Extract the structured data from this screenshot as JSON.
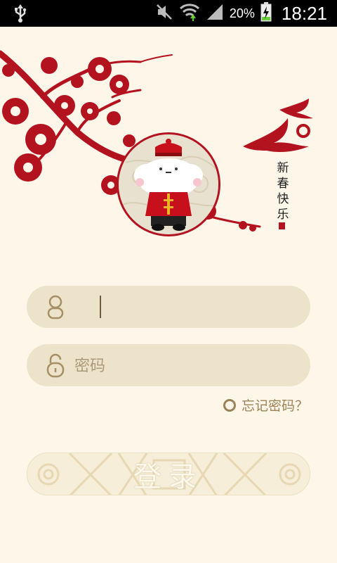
{
  "status_bar": {
    "battery_percent": "20%",
    "time": "18:21",
    "icons": [
      "usb-icon",
      "mute-icon",
      "wifi-icon",
      "signal-icon",
      "battery-icon"
    ]
  },
  "hero": {
    "greeting_chars": [
      "新",
      "春",
      "快",
      "乐"
    ],
    "icons": [
      "plum-blossom-branch",
      "swallow-birds",
      "mascot-avatar"
    ]
  },
  "login_form": {
    "username": {
      "value": "",
      "placeholder": ""
    },
    "password": {
      "value": "",
      "placeholder": "密码"
    },
    "forgot_password_label": "忘记密码？",
    "login_button_label": "登录"
  },
  "colors": {
    "background": "#fdf6e9",
    "field_bg": "#ece3ca",
    "accent_gold": "#9c8357",
    "paper_cut_red": "#b3121f"
  }
}
